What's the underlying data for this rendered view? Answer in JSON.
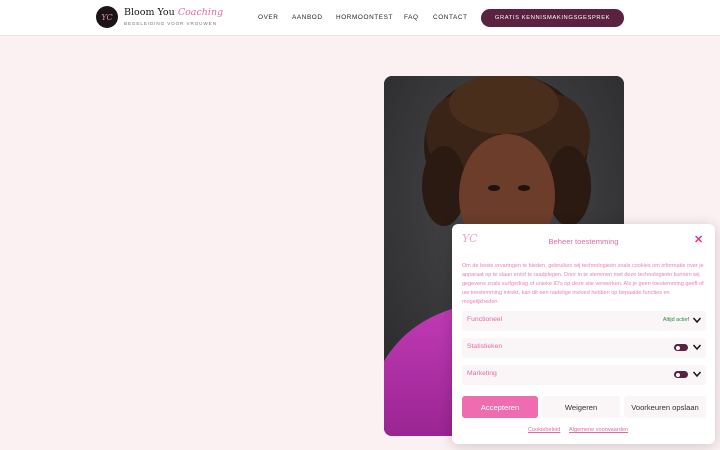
{
  "header": {
    "logo_monogram": "YC",
    "brand_main": "Bloom You",
    "brand_accent": "Coaching",
    "tagline": "BEGELEIDING VOOR VROUWEN",
    "nav": [
      "OVER",
      "AANBOD",
      "HORMOONTEST",
      "FAQ",
      "CONTACT"
    ],
    "cta_label": "GRATIS KENNISMAKINGSGESPREK"
  },
  "consent": {
    "logo_monogram": "YC",
    "title": "Beheer toestemming",
    "close_icon": "close-icon",
    "body": "Om de beste ervaringen te bieden, gebruiken wij technologieën zoals cookies om informatie over je apparaat op te slaan en/of te raadplegen. Door in te stemmen met deze technologieën kunnen wij gegevens zoals surfgedrag of unieke ID's op deze site verwerken. Als je geen toestemming geeft of uw toestemming intrekt, kan dit een nadelige invloed hebben op bepaalde functies en mogelijkheden.",
    "categories": [
      {
        "label": "Functioneel",
        "status": "Altijd actief"
      },
      {
        "label": "Statistieken"
      },
      {
        "label": "Marketing"
      }
    ],
    "buttons": {
      "accept": "Accepteren",
      "deny": "Weigeren",
      "save": "Voorkeuren opslaan"
    },
    "links": {
      "cookie_policy": "Cookiebeleid",
      "terms": "Algemene voorwaarden"
    }
  },
  "colors": {
    "brand_dark": "#5a2140",
    "brand_pink": "#e06aa8",
    "accept_pink": "#f06cb0",
    "page_bg": "#fbf1f3"
  }
}
